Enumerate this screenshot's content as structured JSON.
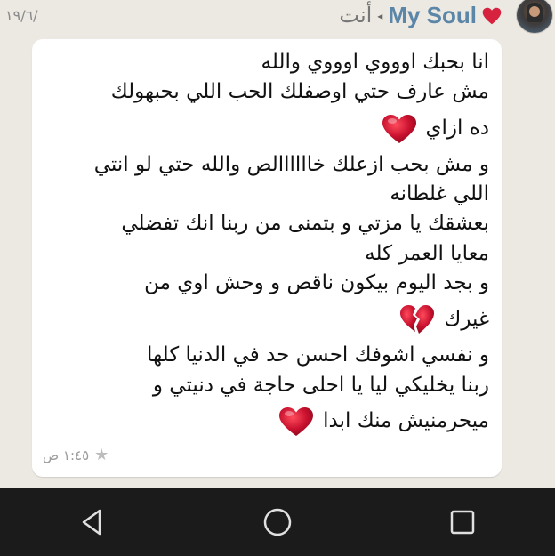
{
  "header": {
    "date": "١٩/٦/",
    "contact_name": "My Soul",
    "recipient": "أنت",
    "arrow": "◂"
  },
  "message": {
    "lines": [
      "انا بحبك اوووي اوووي والله",
      "مش عارف حتي اوصفلك الحب اللي بحبهولك",
      "ده ازاي",
      "و مش بحب ازعلك خاااااالص والله حتي لو انتي",
      "اللي غلطانه",
      "بعشقك يا مزتي و بتمنى من ربنا انك تفضلي",
      "معايا العمر كله",
      "و بجد اليوم بيكون ناقص و وحش اوي من",
      "غيرك",
      "و نفسي اشوفك احسن حد في الدنيا كلها",
      "ربنا يخليكي ليا يا احلى حاجة في دنيتي و",
      "ميحرمنيش منك ابدا"
    ],
    "time": "١:٤٥ ص",
    "starred": true
  },
  "icons": {
    "heart": "red-heart-icon",
    "broken_heart": "broken-heart-icon",
    "star": "star-icon"
  },
  "colors": {
    "heart": "#c8102e",
    "contact_name": "#5b86a8",
    "background": "#ece8e2",
    "bubble": "#ffffff",
    "navbar": "#1b1b1b"
  },
  "navbar": {
    "back": "back-icon",
    "home": "home-icon",
    "recents": "recents-icon"
  }
}
